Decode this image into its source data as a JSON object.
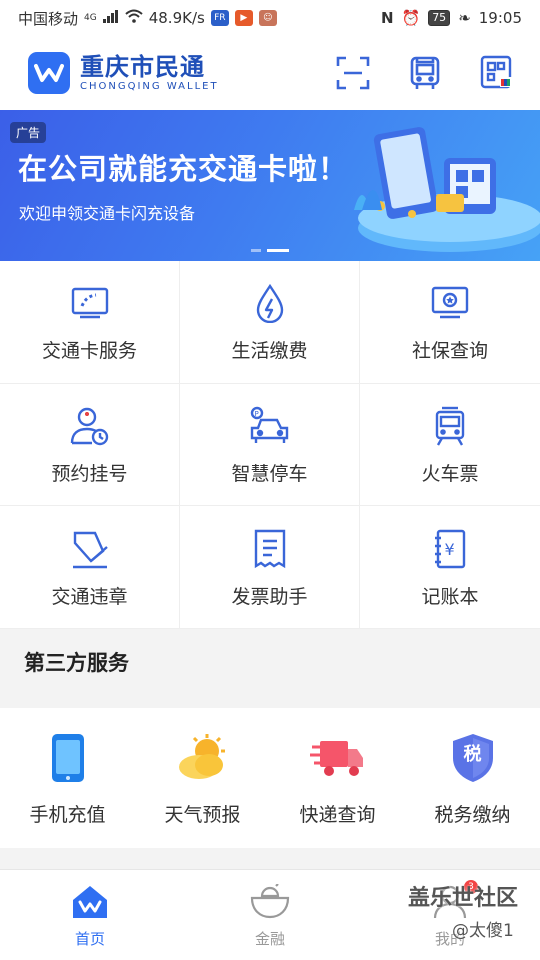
{
  "status_bar": {
    "carrier": "中国移动",
    "net": "4G",
    "speed": "48.9K/s",
    "battery": "75",
    "time": "19:05"
  },
  "header": {
    "app_name": "重庆市民通",
    "app_name_en": "CHONGQING WALLET",
    "icons": [
      "scan-icon",
      "bus-icon",
      "unionpay-qr-icon"
    ]
  },
  "banner": {
    "tag": "广告",
    "title": "在公司就能充交通卡啦！",
    "subtitle": "欢迎申领交通卡闪充设备"
  },
  "services": [
    {
      "label": "交通卡服务",
      "icon": "transit-card-icon"
    },
    {
      "label": "生活缴费",
      "icon": "water-drop-bolt-icon"
    },
    {
      "label": "社保查询",
      "icon": "social-security-icon"
    },
    {
      "label": "预约挂号",
      "icon": "doctor-appointment-icon"
    },
    {
      "label": "智慧停车",
      "icon": "parking-car-icon"
    },
    {
      "label": "火车票",
      "icon": "train-icon"
    },
    {
      "label": "交通违章",
      "icon": "traffic-violation-icon"
    },
    {
      "label": "发票助手",
      "icon": "invoice-icon"
    },
    {
      "label": "记账本",
      "icon": "ledger-icon"
    }
  ],
  "third_party": {
    "title": "第三方服务",
    "items": [
      {
        "label": "手机充值",
        "icon": "phone-recharge-icon"
      },
      {
        "label": "天气预报",
        "icon": "weather-icon"
      },
      {
        "label": "快递查询",
        "icon": "delivery-truck-icon"
      },
      {
        "label": "税务缴纳",
        "icon": "tax-shield-icon",
        "glyph": "税"
      }
    ]
  },
  "bottom_nav": [
    {
      "label": "首页",
      "icon": "home-icon",
      "active": true
    },
    {
      "label": "金融",
      "icon": "finance-ingot-icon",
      "active": false
    },
    {
      "label": "我的",
      "icon": "profile-icon",
      "active": false,
      "badge": "3"
    }
  ],
  "watermark": {
    "line1": "盖乐世社区",
    "line2": "@太傻1"
  },
  "colors": {
    "brand": "#2f6ff2",
    "icon_blue": "#3a66d8",
    "banner_start": "#3b5fe8",
    "banner_end": "#46a2f6"
  }
}
